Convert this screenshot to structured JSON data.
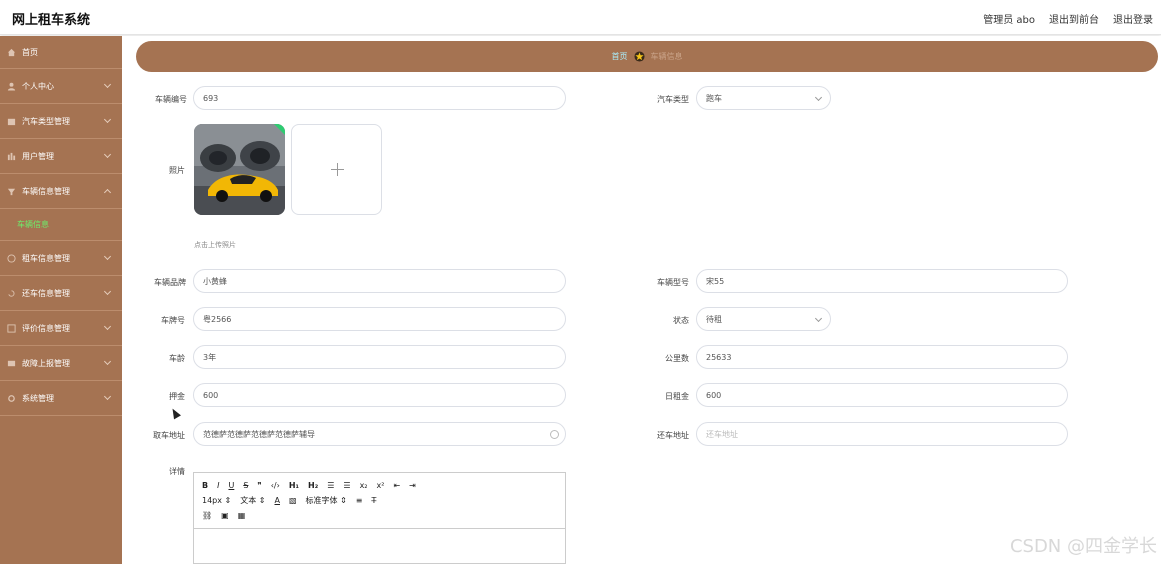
{
  "header": {
    "title": "网上租车系统",
    "admin_label": "管理员 abo",
    "back_front": "退出到前台",
    "logout": "退出登录"
  },
  "sidebar": {
    "items": [
      {
        "label": "首页",
        "icon": "home-icon"
      },
      {
        "label": "个人中心",
        "icon": "user-icon"
      },
      {
        "label": "汽车类型管理",
        "icon": "folder-icon"
      },
      {
        "label": "用户管理",
        "icon": "users-icon"
      },
      {
        "label": "车辆信息管理",
        "icon": "car-icon"
      },
      {
        "label": "租车信息管理",
        "icon": "globe-icon"
      },
      {
        "label": "还车信息管理",
        "icon": "return-icon"
      },
      {
        "label": "评价信息管理",
        "icon": "comment-icon"
      },
      {
        "label": "故障上报管理",
        "icon": "warning-icon"
      },
      {
        "label": "系统管理",
        "icon": "settings-icon"
      }
    ],
    "active_sub": "车辆信息"
  },
  "breadcrumb": {
    "home": "首页",
    "current": "车辆信息"
  },
  "form": {
    "vehicle_no_label": "车辆编号",
    "vehicle_no": "693",
    "car_type_label": "汽车类型",
    "car_type": "跑车",
    "photo_label": "照片",
    "upload_hint": "点击上传照片",
    "brand_label": "车辆品牌",
    "brand": "小黄蜂",
    "model_label": "车辆型号",
    "model": "宋55",
    "plate_label": "车牌号",
    "plate": "粤2566",
    "status_label": "状态",
    "status": "待租",
    "age_label": "车龄",
    "age": "3年",
    "mileage_label": "公里数",
    "mileage": "25633",
    "deposit_label": "押金",
    "deposit": "600",
    "daily_rent_label": "日租金",
    "daily_rent": "600",
    "pickup_label": "取车地址",
    "pickup": "范德萨范德萨范德萨范德萨辅导",
    "return_label": "还车地址",
    "return_placeholder": "还车地址",
    "detail_label": "详情"
  },
  "editor": {
    "font_size": "14px",
    "text_style": "文本",
    "font_family": "标准字体"
  },
  "watermark": "CSDN @四金学长",
  "colors": {
    "sidebar": "#a57352",
    "active_sub": "#6cf06c",
    "crumb_home": "#aaf0ff"
  }
}
